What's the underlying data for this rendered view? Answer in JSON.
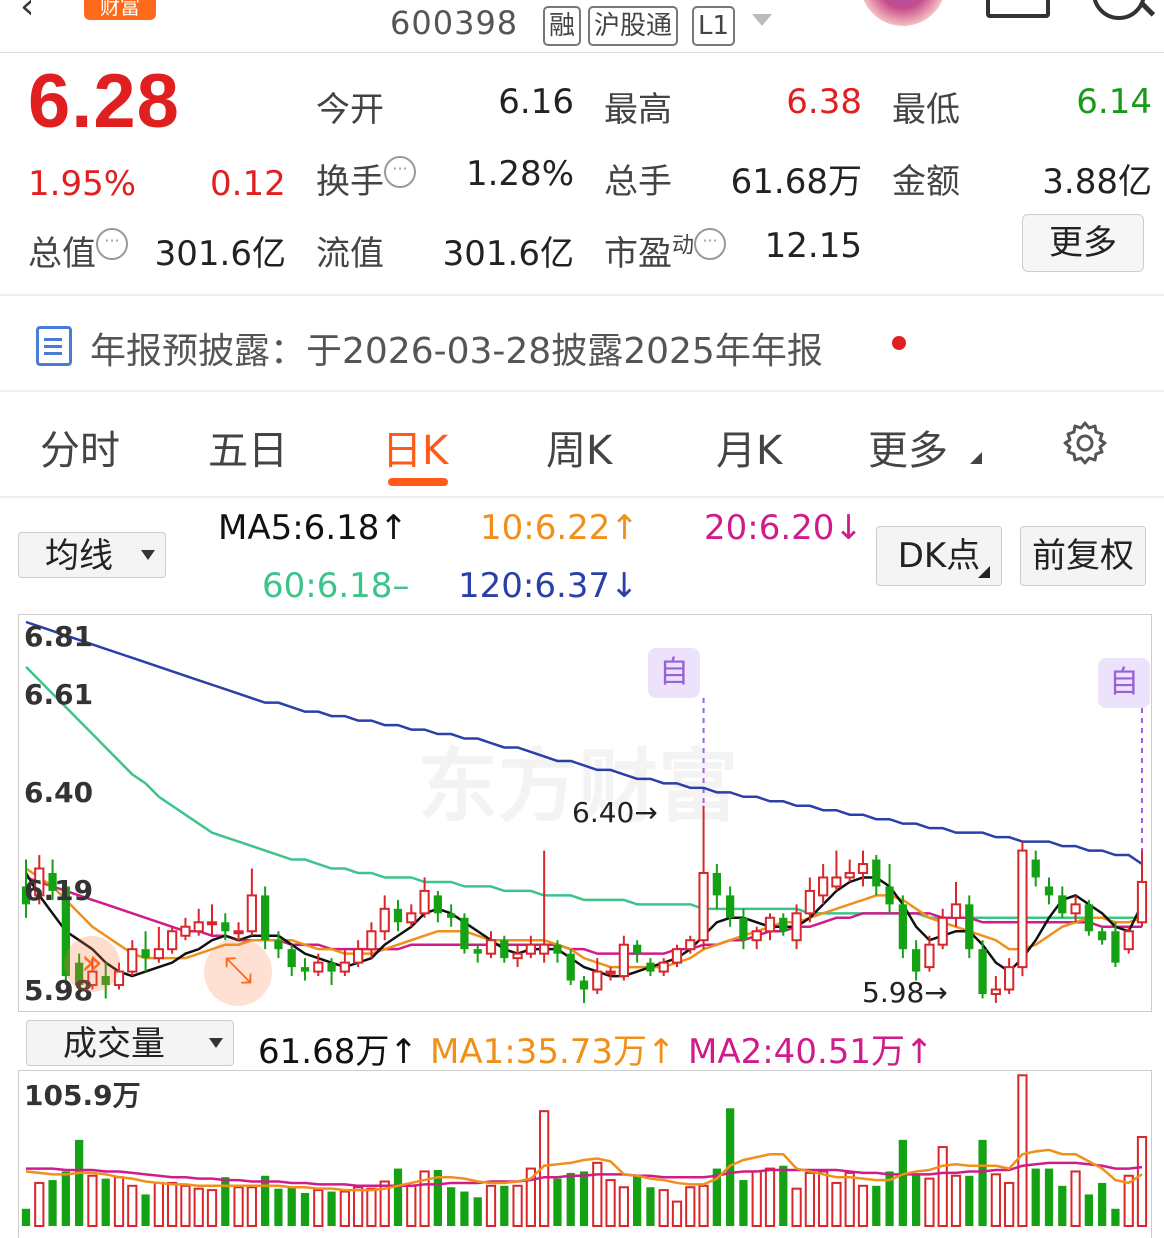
{
  "header": {
    "back_icon": "chevron-left-icon",
    "brand": "财富",
    "code": "600398",
    "tags": [
      "融",
      "沪股通",
      "L1"
    ]
  },
  "quote": {
    "price": "6.28",
    "change_pct": "1.95%",
    "change_amt": "0.12",
    "open_label": "今开",
    "open": "6.16",
    "high_label": "最高",
    "high": "6.38",
    "low_label": "最低",
    "low": "6.14",
    "turnover_label": "换手",
    "turnover": "1.28%",
    "volume_label": "总手",
    "volume": "61.68万",
    "amount_label": "金额",
    "amount": "3.88亿",
    "mktcap_label": "总值",
    "mktcap": "301.6亿",
    "float_label": "流值",
    "float": "301.6亿",
    "pe_label": "市盈",
    "pe_sup": "动",
    "pe": "12.15",
    "more": "更多"
  },
  "notice": {
    "text": "年报预披露：于2026-03-28披露2025年年报"
  },
  "tabs": [
    "分时",
    "五日",
    "日K",
    "周K",
    "月K",
    "更多"
  ],
  "ma": {
    "selector": "均线",
    "ma5": "MA5:6.18↑",
    "ma10": "10:6.22↑",
    "ma20": "20:6.20↓",
    "ma60": "60:6.18–",
    "ma120": "120:6.37↓",
    "dk": "DK点",
    "adjust": "前复权",
    "colors": {
      "ma5": "#111111",
      "ma10": "#f0901a",
      "ma20": "#d01c8b",
      "ma60": "#3cc48a",
      "ma120": "#2a3fa8"
    }
  },
  "kline": {
    "y_labels": [
      "6.81",
      "6.61",
      "6.40",
      "6.19",
      "5.98"
    ],
    "high_marker": "6.40→",
    "low_marker": "5.98→",
    "self_mark": "自",
    "watermark": "东方财富",
    "candles": [
      [
        6.22,
        6.18,
        6.28,
        6.15
      ],
      [
        6.2,
        6.26,
        6.29,
        6.18
      ],
      [
        6.25,
        6.21,
        6.28,
        6.19
      ],
      [
        6.22,
        6.02,
        6.23,
        6.0
      ],
      [
        6.05,
        6.0,
        6.07,
        5.98
      ],
      [
        6.0,
        6.03,
        6.06,
        5.99
      ],
      [
        6.02,
        6.0,
        6.05,
        5.97
      ],
      [
        6.0,
        6.03,
        6.05,
        5.99
      ],
      [
        6.03,
        6.08,
        6.1,
        6.02
      ],
      [
        6.08,
        6.06,
        6.12,
        6.03
      ],
      [
        6.06,
        6.08,
        6.13,
        6.05
      ],
      [
        6.08,
        6.12,
        6.13,
        6.07
      ],
      [
        6.11,
        6.13,
        6.15,
        6.1
      ],
      [
        6.12,
        6.14,
        6.17,
        6.11
      ],
      [
        6.14,
        6.14,
        6.18,
        6.11
      ],
      [
        6.14,
        6.12,
        6.16,
        6.1
      ],
      [
        6.12,
        6.12,
        6.14,
        6.1
      ],
      [
        6.12,
        6.2,
        6.26,
        6.11
      ],
      [
        6.2,
        6.1,
        6.22,
        6.08
      ],
      [
        6.1,
        6.08,
        6.12,
        6.06
      ],
      [
        6.08,
        6.04,
        6.09,
        6.02
      ],
      [
        6.04,
        6.03,
        6.06,
        6.01
      ],
      [
        6.03,
        6.05,
        6.07,
        6.02
      ],
      [
        6.05,
        6.03,
        6.06,
        6.0
      ],
      [
        6.03,
        6.05,
        6.08,
        6.02
      ],
      [
        6.05,
        6.08,
        6.1,
        6.04
      ],
      [
        6.08,
        6.12,
        6.14,
        6.06
      ],
      [
        6.12,
        6.17,
        6.2,
        6.1
      ],
      [
        6.17,
        6.14,
        6.19,
        6.12
      ],
      [
        6.14,
        6.16,
        6.18,
        6.13
      ],
      [
        6.16,
        6.21,
        6.24,
        6.15
      ],
      [
        6.2,
        6.16,
        6.21,
        6.14
      ],
      [
        6.16,
        6.15,
        6.18,
        6.13
      ],
      [
        6.15,
        6.08,
        6.16,
        6.07
      ],
      [
        6.08,
        6.07,
        6.09,
        6.05
      ],
      [
        6.07,
        6.1,
        6.12,
        6.06
      ],
      [
        6.1,
        6.06,
        6.11,
        6.05
      ],
      [
        6.06,
        6.07,
        6.09,
        6.04
      ],
      [
        6.07,
        6.09,
        6.11,
        6.06
      ],
      [
        6.07,
        6.09,
        6.3,
        6.05
      ],
      [
        6.09,
        6.07,
        6.1,
        6.05
      ],
      [
        6.07,
        6.01,
        6.08,
        6.0
      ],
      [
        6.01,
        5.99,
        6.02,
        5.96
      ],
      [
        5.99,
        6.03,
        6.06,
        5.98
      ],
      [
        6.03,
        6.03,
        6.04,
        6.01
      ],
      [
        6.02,
        6.09,
        6.11,
        6.01
      ],
      [
        6.09,
        6.07,
        6.1,
        6.05
      ],
      [
        6.05,
        6.03,
        6.06,
        6.02
      ],
      [
        6.03,
        6.05,
        6.06,
        6.02
      ],
      [
        6.05,
        6.08,
        6.09,
        6.04
      ],
      [
        6.08,
        6.1,
        6.11,
        6.07
      ],
      [
        6.1,
        6.25,
        6.4,
        6.08
      ],
      [
        6.25,
        6.2,
        6.27,
        6.17
      ],
      [
        6.2,
        6.15,
        6.22,
        6.13
      ],
      [
        6.15,
        6.1,
        6.17,
        6.08
      ],
      [
        6.1,
        6.12,
        6.13,
        6.08
      ],
      [
        6.12,
        6.15,
        6.16,
        6.1
      ],
      [
        6.15,
        6.12,
        6.16,
        6.11
      ],
      [
        6.1,
        6.16,
        6.18,
        6.08
      ],
      [
        6.16,
        6.21,
        6.24,
        6.14
      ],
      [
        6.2,
        6.24,
        6.27,
        6.18
      ],
      [
        6.22,
        6.24,
        6.3,
        6.21
      ],
      [
        6.24,
        6.25,
        6.28,
        6.23
      ],
      [
        6.25,
        6.27,
        6.3,
        6.22
      ],
      [
        6.28,
        6.22,
        6.29,
        6.2
      ],
      [
        6.22,
        6.18,
        6.27,
        6.16
      ],
      [
        6.18,
        6.08,
        6.2,
        6.06
      ],
      [
        6.08,
        6.03,
        6.1,
        6.01
      ],
      [
        6.04,
        6.09,
        6.11,
        6.03
      ],
      [
        6.09,
        6.15,
        6.17,
        6.08
      ],
      [
        6.15,
        6.18,
        6.23,
        6.13
      ],
      [
        6.18,
        6.08,
        6.2,
        6.06
      ],
      [
        6.08,
        5.98,
        6.1,
        5.97
      ],
      [
        5.98,
        5.99,
        6.02,
        5.96
      ],
      [
        5.99,
        6.04,
        6.06,
        5.98
      ],
      [
        6.04,
        6.3,
        6.32,
        6.02
      ],
      [
        6.28,
        6.24,
        6.3,
        6.22
      ],
      [
        6.22,
        6.2,
        6.24,
        6.18
      ],
      [
        6.2,
        6.16,
        6.22,
        6.15
      ],
      [
        6.16,
        6.18,
        6.2,
        6.14
      ],
      [
        6.18,
        6.12,
        6.19,
        6.11
      ],
      [
        6.12,
        6.1,
        6.13,
        6.09
      ],
      [
        6.12,
        6.05,
        6.14,
        6.04
      ],
      [
        6.08,
        6.12,
        6.13,
        6.07
      ],
      [
        6.14,
        6.23,
        6.3,
        6.13
      ]
    ],
    "ma5": [
      6.25,
      6.2,
      6.16,
      6.12,
      6.1,
      6.08,
      6.05,
      6.03,
      6.02,
      6.03,
      6.04,
      6.05,
      6.07,
      6.08,
      6.1,
      6.11,
      6.1,
      6.11,
      6.11,
      6.11,
      6.09,
      6.07,
      6.06,
      6.05,
      6.04,
      6.05,
      6.06,
      6.09,
      6.11,
      6.13,
      6.16,
      6.17,
      6.16,
      6.14,
      6.12,
      6.1,
      6.08,
      6.07,
      6.08,
      6.08,
      6.08,
      6.06,
      6.04,
      6.03,
      6.02,
      6.02,
      6.03,
      6.04,
      6.05,
      6.06,
      6.08,
      6.11,
      6.14,
      6.15,
      6.15,
      6.14,
      6.13,
      6.13,
      6.13,
      6.15,
      6.18,
      6.21,
      6.23,
      6.24,
      6.24,
      6.22,
      6.18,
      6.13,
      6.1,
      6.11,
      6.12,
      6.12,
      6.09,
      6.05,
      6.03,
      6.06,
      6.1,
      6.15,
      6.19,
      6.2,
      6.18,
      6.16,
      6.13,
      6.12,
      6.18
    ],
    "ma10": [
      6.26,
      6.24,
      6.22,
      6.19,
      6.16,
      6.13,
      6.11,
      6.09,
      6.07,
      6.06,
      6.06,
      6.06,
      6.06,
      6.07,
      6.08,
      6.09,
      6.09,
      6.1,
      6.1,
      6.1,
      6.1,
      6.09,
      6.08,
      6.08,
      6.07,
      6.07,
      6.07,
      6.08,
      6.09,
      6.1,
      6.11,
      6.12,
      6.12,
      6.12,
      6.11,
      6.1,
      6.1,
      6.1,
      6.1,
      6.1,
      6.09,
      6.08,
      6.06,
      6.05,
      6.04,
      6.04,
      6.04,
      6.04,
      6.04,
      6.05,
      6.06,
      6.08,
      6.09,
      6.1,
      6.11,
      6.12,
      6.13,
      6.14,
      6.14,
      6.15,
      6.16,
      6.17,
      6.18,
      6.19,
      6.2,
      6.2,
      6.19,
      6.17,
      6.15,
      6.14,
      6.13,
      6.12,
      6.11,
      6.1,
      6.08,
      6.08,
      6.09,
      6.11,
      6.13,
      6.14,
      6.15,
      6.15,
      6.14,
      6.14,
      6.15
    ],
    "ma20": [
      6.24,
      6.23,
      6.22,
      6.21,
      6.2,
      6.19,
      6.18,
      6.17,
      6.16,
      6.15,
      6.14,
      6.13,
      6.12,
      6.12,
      6.11,
      6.11,
      6.1,
      6.1,
      6.1,
      6.1,
      6.09,
      6.09,
      6.09,
      6.08,
      6.08,
      6.08,
      6.08,
      6.08,
      6.08,
      6.09,
      6.09,
      6.09,
      6.09,
      6.09,
      6.09,
      6.09,
      6.09,
      6.09,
      6.09,
      6.09,
      6.09,
      6.08,
      6.08,
      6.07,
      6.07,
      6.07,
      6.07,
      6.07,
      6.07,
      6.08,
      6.08,
      6.09,
      6.09,
      6.1,
      6.1,
      6.11,
      6.12,
      6.12,
      6.13,
      6.13,
      6.14,
      6.15,
      6.15,
      6.16,
      6.16,
      6.16,
      6.16,
      6.16,
      6.16,
      6.15,
      6.15,
      6.15,
      6.14,
      6.14,
      6.14,
      6.14,
      6.14,
      6.14,
      6.14,
      6.14,
      6.14,
      6.13,
      6.13,
      6.13,
      6.13
    ],
    "ma60": [
      6.71,
      6.68,
      6.65,
      6.62,
      6.59,
      6.56,
      6.53,
      6.5,
      6.47,
      6.45,
      6.42,
      6.4,
      6.38,
      6.36,
      6.34,
      6.33,
      6.32,
      6.31,
      6.3,
      6.29,
      6.28,
      6.28,
      6.27,
      6.26,
      6.26,
      6.25,
      6.25,
      6.24,
      6.24,
      6.24,
      6.23,
      6.23,
      6.23,
      6.22,
      6.22,
      6.22,
      6.21,
      6.21,
      6.21,
      6.2,
      6.2,
      6.2,
      6.19,
      6.19,
      6.19,
      6.19,
      6.18,
      6.18,
      6.18,
      6.18,
      6.18,
      6.17,
      6.17,
      6.17,
      6.17,
      6.17,
      6.17,
      6.17,
      6.17,
      6.16,
      6.16,
      6.16,
      6.16,
      6.16,
      6.16,
      6.16,
      6.16,
      6.16,
      6.15,
      6.15,
      6.15,
      6.15,
      6.15,
      6.15,
      6.15,
      6.15,
      6.15,
      6.15,
      6.15,
      6.15,
      6.15,
      6.15,
      6.15,
      6.15,
      6.15
    ],
    "ma120": [
      6.81,
      6.8,
      6.79,
      6.78,
      6.77,
      6.76,
      6.75,
      6.74,
      6.73,
      6.72,
      6.71,
      6.7,
      6.69,
      6.68,
      6.67,
      6.66,
      6.65,
      6.64,
      6.63,
      6.63,
      6.62,
      6.61,
      6.61,
      6.6,
      6.6,
      6.59,
      6.59,
      6.58,
      6.58,
      6.57,
      6.57,
      6.56,
      6.56,
      6.55,
      6.55,
      6.54,
      6.53,
      6.53,
      6.52,
      6.51,
      6.5,
      6.5,
      6.49,
      6.48,
      6.48,
      6.47,
      6.46,
      6.46,
      6.45,
      6.45,
      6.44,
      6.44,
      6.43,
      6.43,
      6.42,
      6.42,
      6.41,
      6.41,
      6.4,
      6.4,
      6.39,
      6.39,
      6.38,
      6.38,
      6.37,
      6.37,
      6.36,
      6.36,
      6.35,
      6.35,
      6.34,
      6.34,
      6.34,
      6.33,
      6.33,
      6.32,
      6.32,
      6.32,
      6.31,
      6.31,
      6.3,
      6.3,
      6.29,
      6.29,
      6.27
    ]
  },
  "volume": {
    "selector": "成交量",
    "current": "61.68万↑",
    "ma1": "MA1:35.73万↑",
    "ma2": "MA2:40.51万↑",
    "max_label": "105.9万",
    "bars": [
      12,
      30,
      32,
      38,
      60,
      35,
      33,
      34,
      28,
      22,
      30,
      30,
      28,
      26,
      25,
      34,
      27,
      27,
      35,
      26,
      27,
      23,
      25,
      24,
      24,
      27,
      26,
      31,
      40,
      28,
      38,
      39,
      27,
      24,
      20,
      28,
      28,
      28,
      40,
      80,
      33,
      37,
      38,
      44,
      32,
      27,
      35,
      27,
      25,
      17,
      27,
      28,
      40,
      82,
      32,
      38,
      40,
      42,
      26,
      37,
      38,
      30,
      37,
      28,
      28,
      38,
      60,
      36,
      33,
      55,
      35,
      35,
      60,
      36,
      30,
      105,
      40,
      40,
      28,
      38,
      22,
      30,
      12,
      35,
      62
    ],
    "ma1_line": [
      38,
      37,
      36,
      36,
      37,
      37,
      36,
      34,
      33,
      31,
      30,
      29,
      29,
      28,
      28,
      28,
      28,
      28,
      28,
      28,
      27,
      27,
      26,
      26,
      25,
      25,
      25,
      26,
      28,
      30,
      32,
      34,
      34,
      33,
      31,
      30,
      30,
      31,
      33,
      42,
      43,
      44,
      46,
      47,
      45,
      36,
      35,
      33,
      32,
      30,
      29,
      29,
      33,
      42,
      46,
      48,
      50,
      50,
      40,
      38,
      36,
      34,
      34,
      33,
      32,
      32,
      36,
      38,
      39,
      42,
      43,
      42,
      42,
      42,
      40,
      50,
      52,
      53,
      50,
      50,
      45,
      40,
      32,
      30,
      36
    ],
    "ma2_line": [
      40,
      40,
      40,
      39,
      39,
      39,
      38,
      38,
      37,
      36,
      35,
      34,
      34,
      33,
      33,
      32,
      32,
      31,
      31,
      31,
      30,
      30,
      29,
      29,
      29,
      28,
      28,
      28,
      28,
      28,
      29,
      29,
      30,
      30,
      30,
      31,
      31,
      31,
      32,
      34,
      34,
      35,
      35,
      36,
      36,
      36,
      35,
      35,
      34,
      34,
      34,
      34,
      35,
      37,
      38,
      38,
      39,
      39,
      39,
      39,
      39,
      39,
      38,
      37,
      37,
      36,
      36,
      36,
      36,
      37,
      37,
      38,
      38,
      39,
      39,
      42,
      43,
      44,
      44,
      44,
      43,
      42,
      40,
      40,
      41
    ]
  }
}
